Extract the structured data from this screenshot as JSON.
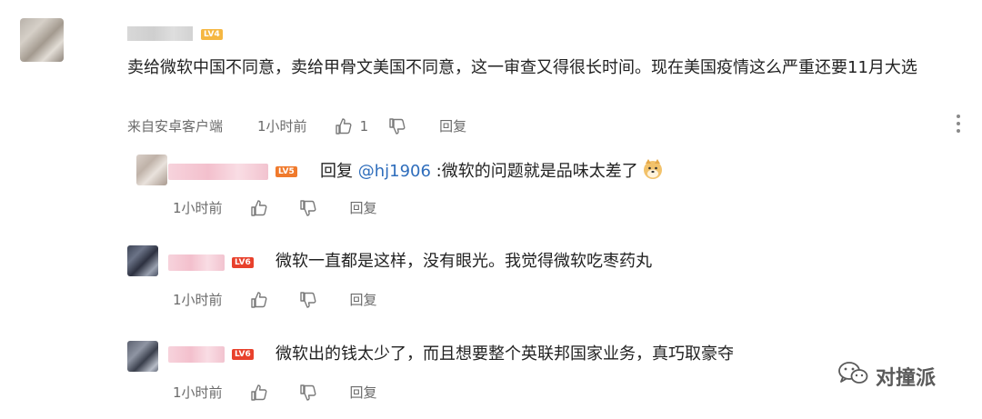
{
  "main_comment": {
    "level_badge": "LV4",
    "text": "卖给微软中国不同意，卖给甲骨文美国不同意，这一审查又得很长时间。现在美国疫情这么严重还要11月大选",
    "source": "来自安卓客户端",
    "time": "1小时前",
    "like_count": "1",
    "reply_label": "回复"
  },
  "replies": [
    {
      "level_badge": "LV5",
      "reply_prefix": "回复 ",
      "mention": "@hj1906",
      "text": " :微软的问题就是品味太差了",
      "time": "1小时前",
      "reply_label": "回复",
      "emoji": "doge-emoji"
    },
    {
      "level_badge": "LV6",
      "text": "微软一直都是这样，没有眼光。我觉得微软吃枣药丸",
      "time": "1小时前",
      "reply_label": "回复"
    },
    {
      "level_badge": "LV6",
      "text": "微软出的钱太少了，而且想要整个英联邦国家业务，真巧取豪夺",
      "time": "1小时前",
      "reply_label": "回复"
    }
  ],
  "watermark": {
    "text": "对撞派",
    "icon": "wechat-icon"
  },
  "colors": {
    "mention": "#2f6ebc",
    "meta_text": "#6b6b6b",
    "lv4": "#f5b742",
    "lv5": "#f07a2c",
    "lv6": "#e8412c"
  }
}
